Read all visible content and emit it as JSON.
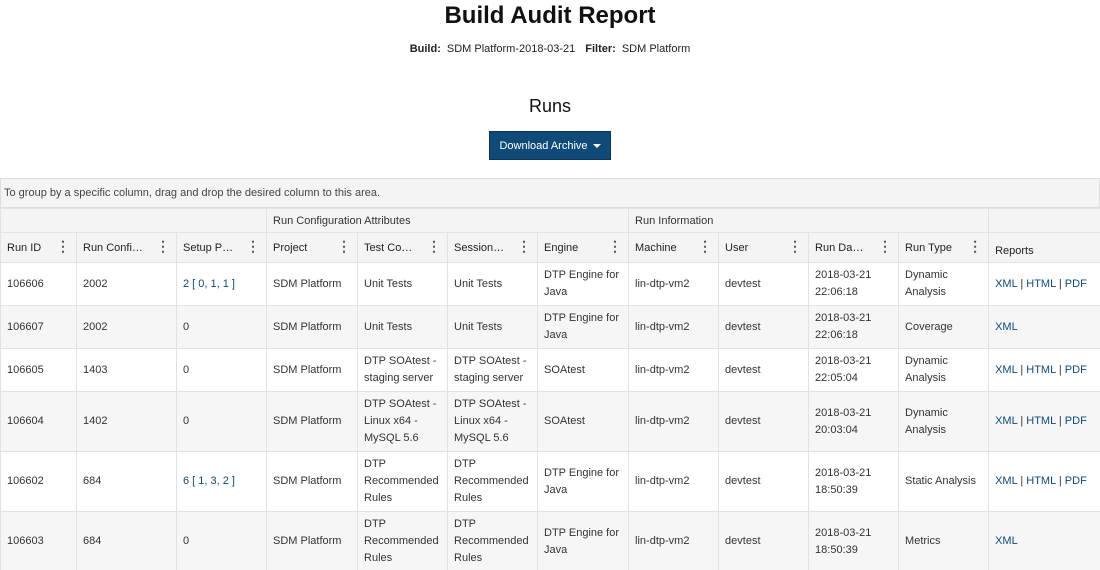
{
  "header": {
    "title": "Build Audit Report",
    "build_label": "Build:",
    "build_value": "SDM Platform-2018-03-21",
    "filter_label": "Filter:",
    "filter_value": "SDM Platform"
  },
  "runs": {
    "title": "Runs",
    "download_label": "Download Archive"
  },
  "grid": {
    "group_hint": "To group by a specific column, drag and drop the desired column to this area.",
    "group_headers": [
      "Run Configuration Attributes",
      "Run Information"
    ],
    "columns": [
      "Run ID",
      "Run Confi…",
      "Setup P…",
      "Project",
      "Test Co…",
      "Session…",
      "Engine",
      "Machine",
      "User",
      "Run Da…",
      "Run Type",
      "Reports"
    ],
    "rows": [
      {
        "run_id": "106606",
        "run_config": "2002",
        "setup": "2 [ 0, 1, 1 ]",
        "project": "SDM Platform",
        "test_config": "Unit Tests",
        "session": "Unit Tests",
        "engine": "DTP Engine for Java",
        "machine": "lin-dtp-vm2",
        "user": "devtest",
        "run_date": "2018-03-21 22:06:18",
        "run_type": "Dynamic Analysis",
        "reports": [
          "XML",
          "HTML",
          "PDF"
        ]
      },
      {
        "run_id": "106607",
        "run_config": "2002",
        "setup": "0",
        "project": "SDM Platform",
        "test_config": "Unit Tests",
        "session": "Unit Tests",
        "engine": "DTP Engine for Java",
        "machine": "lin-dtp-vm2",
        "user": "devtest",
        "run_date": "2018-03-21 22:06:18",
        "run_type": "Coverage",
        "reports": [
          "XML"
        ]
      },
      {
        "run_id": "106605",
        "run_config": "1403",
        "setup": "0",
        "project": "SDM Platform",
        "test_config": "DTP SOAtest - staging server",
        "session": "DTP SOAtest - staging server",
        "engine": "SOAtest",
        "machine": "lin-dtp-vm2",
        "user": "devtest",
        "run_date": "2018-03-21 22:05:04",
        "run_type": "Dynamic Analysis",
        "reports": [
          "XML",
          "HTML",
          "PDF"
        ]
      },
      {
        "run_id": "106604",
        "run_config": "1402",
        "setup": "0",
        "project": "SDM Platform",
        "test_config": "DTP SOAtest - Linux x64 - MySQL 5.6",
        "session": "DTP SOAtest - Linux x64 - MySQL 5.6",
        "engine": "SOAtest",
        "machine": "lin-dtp-vm2",
        "user": "devtest",
        "run_date": "2018-03-21 20:03:04",
        "run_type": "Dynamic Analysis",
        "reports": [
          "XML",
          "HTML",
          "PDF"
        ]
      },
      {
        "run_id": "106602",
        "run_config": "684",
        "setup": "6 [ 1, 3, 2 ]",
        "project": "SDM Platform",
        "test_config": "DTP Recommended Rules",
        "session": "DTP Recommended Rules",
        "engine": "DTP Engine for Java",
        "machine": "lin-dtp-vm2",
        "user": "devtest",
        "run_date": "2018-03-21 18:50:39",
        "run_type": "Static Analysis",
        "reports": [
          "XML",
          "HTML",
          "PDF"
        ]
      },
      {
        "run_id": "106603",
        "run_config": "684",
        "setup": "0",
        "project": "SDM Platform",
        "test_config": "DTP Recommended Rules",
        "session": "DTP Recommended Rules",
        "engine": "DTP Engine for Java",
        "machine": "lin-dtp-vm2",
        "user": "devtest",
        "run_date": "2018-03-21 18:50:39",
        "run_type": "Metrics",
        "reports": [
          "XML"
        ]
      }
    ]
  },
  "colors": {
    "accent": "#0f4a78",
    "header_bg": "#f4f4f4",
    "stripe": "#f6f6f6"
  },
  "icons": {
    "column_menu": "kebab-icon",
    "dropdown": "caret-down-icon"
  }
}
